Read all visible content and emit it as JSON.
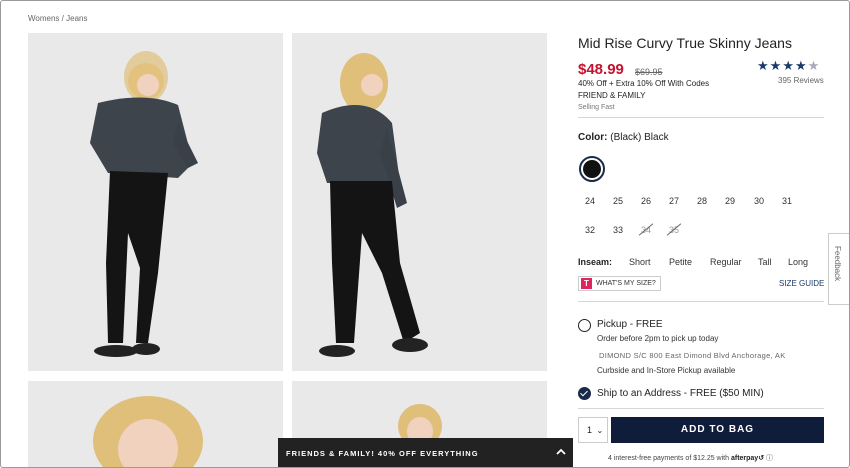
{
  "breadcrumb": {
    "womens": "Womens",
    "sep": "/",
    "jeans": "Jeans"
  },
  "product": {
    "title": "Mid Rise Curvy True Skinny Jeans",
    "price": "$48.99",
    "original_price": "$69.95",
    "rating": 4.5,
    "reviews": "395 Reviews",
    "promo_line1": "40% Off + Extra 10% Off With Codes",
    "promo_line2": "FRIEND & FAMILY",
    "selling_fast": "Selling Fast"
  },
  "color": {
    "label": "Color:",
    "value": "(Black) Black",
    "swatch_hex": "#111111"
  },
  "sizes": [
    {
      "label": "24",
      "available": true
    },
    {
      "label": "25",
      "available": true
    },
    {
      "label": "26",
      "available": true
    },
    {
      "label": "27",
      "available": true
    },
    {
      "label": "28",
      "available": true
    },
    {
      "label": "29",
      "available": true
    },
    {
      "label": "30",
      "available": true
    },
    {
      "label": "31",
      "available": true
    },
    {
      "label": "32",
      "available": true
    },
    {
      "label": "33",
      "available": true
    },
    {
      "label": "34",
      "available": false
    },
    {
      "label": "35",
      "available": false
    }
  ],
  "inseam": {
    "label": "Inseam:",
    "options": [
      "Short",
      "Petite",
      "Regular",
      "Tall",
      "Long"
    ]
  },
  "whats_my_size": {
    "icon": "T",
    "label": "WHAT'S MY SIZE?"
  },
  "size_guide": "SIZE GUIDE",
  "fulfillment": {
    "pickup": {
      "title": "Pickup - FREE",
      "subtitle": "Order before 2pm to pick up today",
      "address": "DIMOND S/C 800 East Dimond Blvd  Anchorage, AK",
      "note": "Curbside and In-Store Pickup available",
      "selected": false
    },
    "ship": {
      "title": "Ship to an Address - FREE ($50 MIN)",
      "selected": true
    }
  },
  "cart": {
    "quantity": "1",
    "qty_caret": "⌄",
    "add_label": "ADD TO BAG",
    "afterpay_text": "4 interest-free payments of $12.25 with",
    "afterpay_brand": "afterpay↺",
    "info_icon": "ⓘ"
  },
  "feedback": "Feedback",
  "banner": "FRIENDS & FAMILY! 40% OFF EVERYTHING",
  "colors": {
    "price_red": "#c4122f",
    "navy": "#0f1c3a",
    "star": "#1a3a6b"
  }
}
